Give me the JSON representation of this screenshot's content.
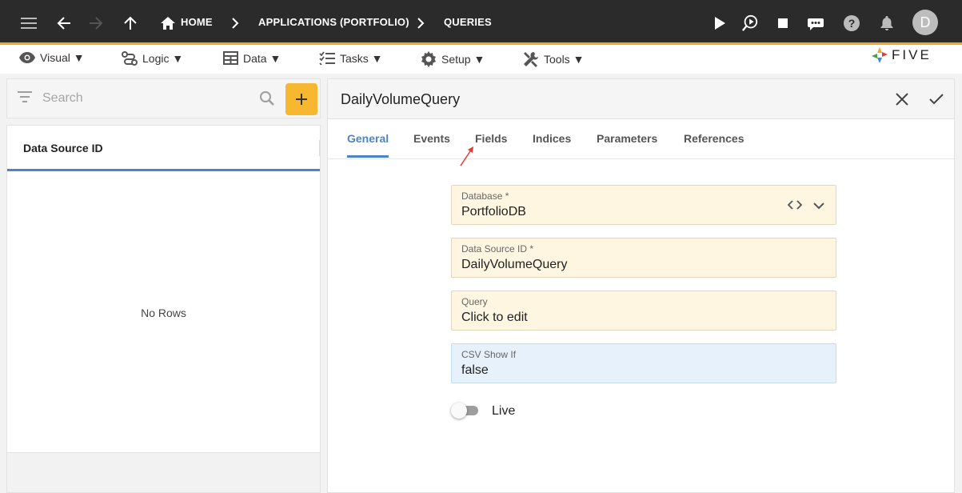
{
  "topbar": {
    "breadcrumbs": [
      {
        "label": "HOME"
      },
      {
        "label": "APPLICATIONS (PORTFOLIO)"
      },
      {
        "label": "QUERIES"
      }
    ],
    "avatar_initial": "D",
    "accent_color": "#f5a623"
  },
  "menubar": {
    "items": [
      {
        "label": "Visual ▼",
        "icon": "eye-icon"
      },
      {
        "label": "Logic ▼",
        "icon": "logic-icon"
      },
      {
        "label": "Data ▼",
        "icon": "table-icon"
      },
      {
        "label": "Tasks ▼",
        "icon": "tasks-icon"
      },
      {
        "label": "Setup ▼",
        "icon": "gear-icon"
      },
      {
        "label": "Tools ▼",
        "icon": "tools-icon"
      }
    ],
    "logo_text": "FIVE"
  },
  "left": {
    "search_placeholder": "Search",
    "column_header": "Data Source ID",
    "empty_text": "No Rows"
  },
  "form": {
    "title": "DailyVolumeQuery",
    "tabs": [
      {
        "label": "General",
        "active": true
      },
      {
        "label": "Events"
      },
      {
        "label": "Fields"
      },
      {
        "label": "Indices"
      },
      {
        "label": "Parameters"
      },
      {
        "label": "References"
      }
    ],
    "fields": {
      "database": {
        "label": "Database *",
        "value": "PortfolioDB"
      },
      "data_source_id": {
        "label": "Data Source ID *",
        "value": "DailyVolumeQuery"
      },
      "query": {
        "label": "Query",
        "value": "Click to edit"
      },
      "csv_show_if": {
        "label": "CSV Show If",
        "value": "false"
      }
    },
    "live_label": "Live",
    "live_on": false
  }
}
